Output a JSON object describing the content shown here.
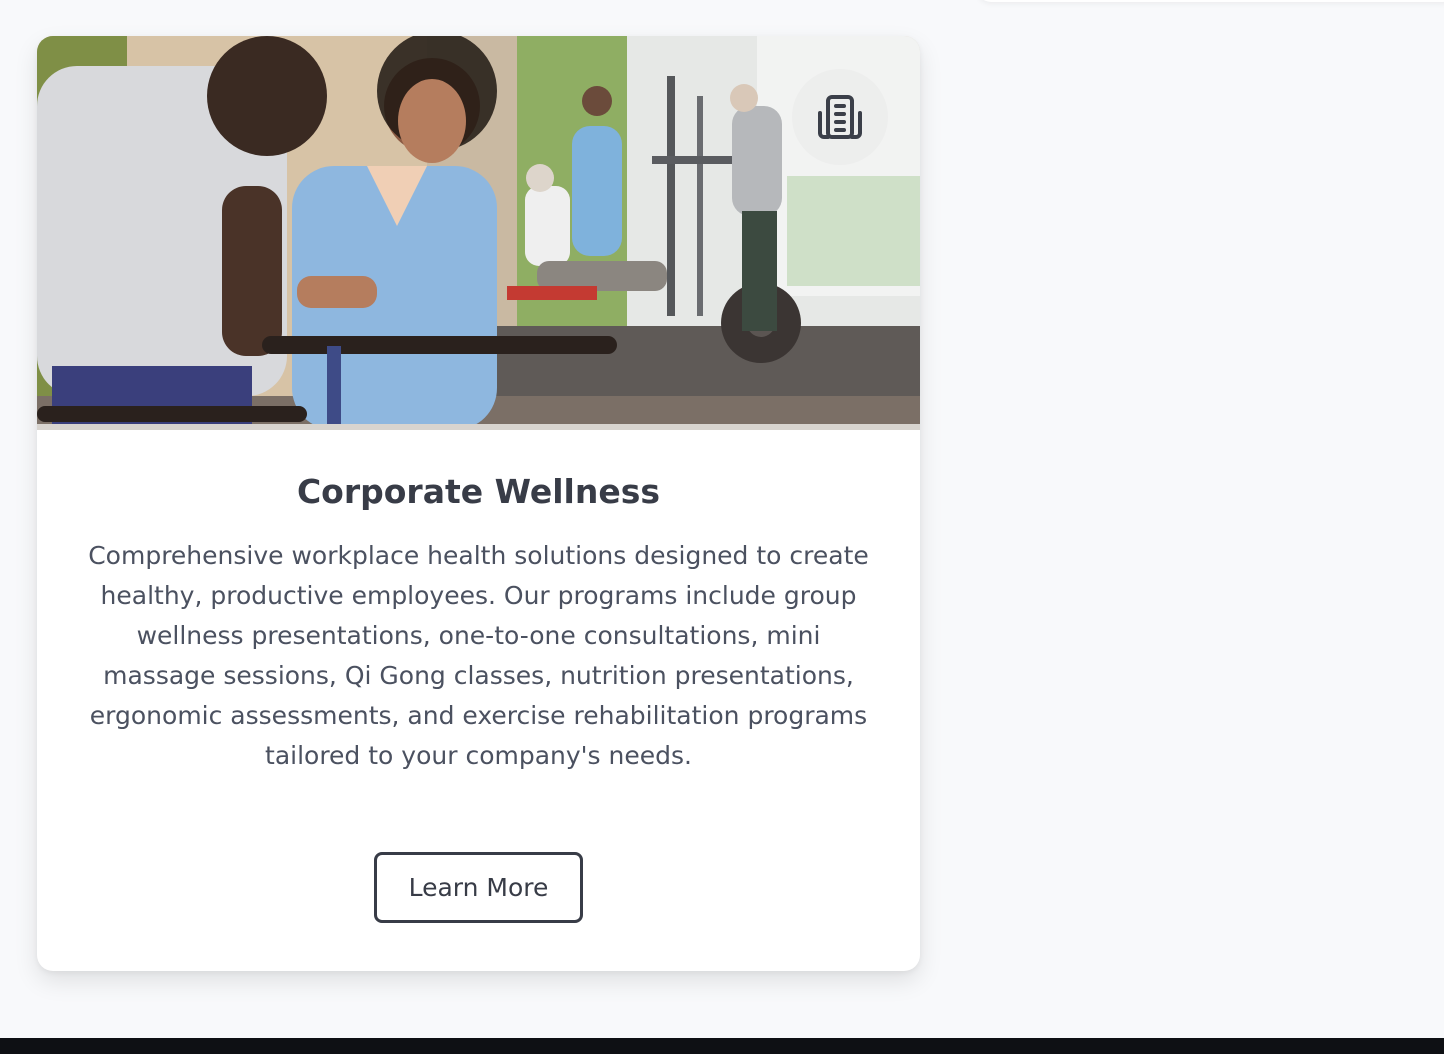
{
  "services": {
    "corporate_wellness": {
      "title": "Corporate Wellness",
      "description": "Comprehensive workplace health solutions designed to create healthy, productive employees. Our programs include group wellness presentations, one-to-one consultations, mini massage sessions, Qi Gong classes, nutrition presentations, ergonomic assessments, and exercise rehabilitation programs tailored to your company's needs.",
      "button_label": "Learn More",
      "icon": "building-icon",
      "image": "physical-therapy-photo"
    }
  },
  "colors": {
    "page_background": "#f8f9fb",
    "card_background": "#ffffff",
    "heading": "#383c47",
    "body_text": "#4b5160",
    "footer": "#0e1014"
  }
}
